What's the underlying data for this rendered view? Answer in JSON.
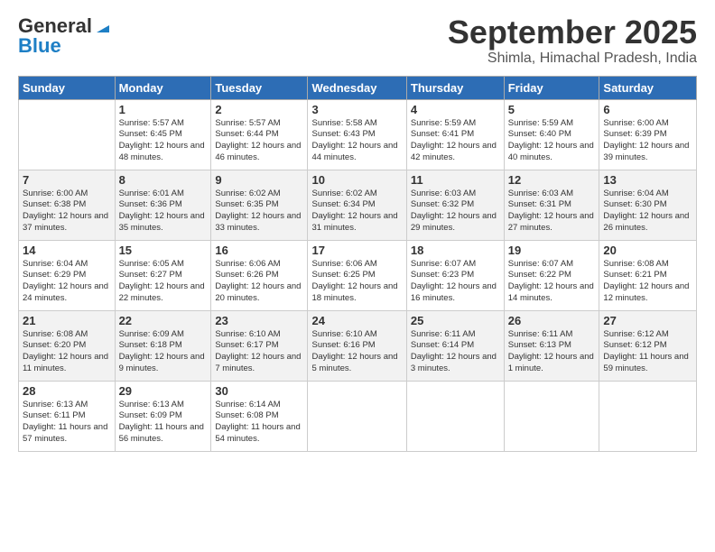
{
  "logo": {
    "general": "General",
    "blue": "Blue"
  },
  "header": {
    "month": "September 2025",
    "location": "Shimla, Himachal Pradesh, India"
  },
  "days_of_week": [
    "Sunday",
    "Monday",
    "Tuesday",
    "Wednesday",
    "Thursday",
    "Friday",
    "Saturday"
  ],
  "weeks": [
    [
      {
        "day": "",
        "info": ""
      },
      {
        "day": "1",
        "info": "Sunrise: 5:57 AM\nSunset: 6:45 PM\nDaylight: 12 hours\nand 48 minutes."
      },
      {
        "day": "2",
        "info": "Sunrise: 5:57 AM\nSunset: 6:44 PM\nDaylight: 12 hours\nand 46 minutes."
      },
      {
        "day": "3",
        "info": "Sunrise: 5:58 AM\nSunset: 6:43 PM\nDaylight: 12 hours\nand 44 minutes."
      },
      {
        "day": "4",
        "info": "Sunrise: 5:59 AM\nSunset: 6:41 PM\nDaylight: 12 hours\nand 42 minutes."
      },
      {
        "day": "5",
        "info": "Sunrise: 5:59 AM\nSunset: 6:40 PM\nDaylight: 12 hours\nand 40 minutes."
      },
      {
        "day": "6",
        "info": "Sunrise: 6:00 AM\nSunset: 6:39 PM\nDaylight: 12 hours\nand 39 minutes."
      }
    ],
    [
      {
        "day": "7",
        "info": "Sunrise: 6:00 AM\nSunset: 6:38 PM\nDaylight: 12 hours\nand 37 minutes."
      },
      {
        "day": "8",
        "info": "Sunrise: 6:01 AM\nSunset: 6:36 PM\nDaylight: 12 hours\nand 35 minutes."
      },
      {
        "day": "9",
        "info": "Sunrise: 6:02 AM\nSunset: 6:35 PM\nDaylight: 12 hours\nand 33 minutes."
      },
      {
        "day": "10",
        "info": "Sunrise: 6:02 AM\nSunset: 6:34 PM\nDaylight: 12 hours\nand 31 minutes."
      },
      {
        "day": "11",
        "info": "Sunrise: 6:03 AM\nSunset: 6:32 PM\nDaylight: 12 hours\nand 29 minutes."
      },
      {
        "day": "12",
        "info": "Sunrise: 6:03 AM\nSunset: 6:31 PM\nDaylight: 12 hours\nand 27 minutes."
      },
      {
        "day": "13",
        "info": "Sunrise: 6:04 AM\nSunset: 6:30 PM\nDaylight: 12 hours\nand 26 minutes."
      }
    ],
    [
      {
        "day": "14",
        "info": "Sunrise: 6:04 AM\nSunset: 6:29 PM\nDaylight: 12 hours\nand 24 minutes."
      },
      {
        "day": "15",
        "info": "Sunrise: 6:05 AM\nSunset: 6:27 PM\nDaylight: 12 hours\nand 22 minutes."
      },
      {
        "day": "16",
        "info": "Sunrise: 6:06 AM\nSunset: 6:26 PM\nDaylight: 12 hours\nand 20 minutes."
      },
      {
        "day": "17",
        "info": "Sunrise: 6:06 AM\nSunset: 6:25 PM\nDaylight: 12 hours\nand 18 minutes."
      },
      {
        "day": "18",
        "info": "Sunrise: 6:07 AM\nSunset: 6:23 PM\nDaylight: 12 hours\nand 16 minutes."
      },
      {
        "day": "19",
        "info": "Sunrise: 6:07 AM\nSunset: 6:22 PM\nDaylight: 12 hours\nand 14 minutes."
      },
      {
        "day": "20",
        "info": "Sunrise: 6:08 AM\nSunset: 6:21 PM\nDaylight: 12 hours\nand 12 minutes."
      }
    ],
    [
      {
        "day": "21",
        "info": "Sunrise: 6:08 AM\nSunset: 6:20 PM\nDaylight: 12 hours\nand 11 minutes."
      },
      {
        "day": "22",
        "info": "Sunrise: 6:09 AM\nSunset: 6:18 PM\nDaylight: 12 hours\nand 9 minutes."
      },
      {
        "day": "23",
        "info": "Sunrise: 6:10 AM\nSunset: 6:17 PM\nDaylight: 12 hours\nand 7 minutes."
      },
      {
        "day": "24",
        "info": "Sunrise: 6:10 AM\nSunset: 6:16 PM\nDaylight: 12 hours\nand 5 minutes."
      },
      {
        "day": "25",
        "info": "Sunrise: 6:11 AM\nSunset: 6:14 PM\nDaylight: 12 hours\nand 3 minutes."
      },
      {
        "day": "26",
        "info": "Sunrise: 6:11 AM\nSunset: 6:13 PM\nDaylight: 12 hours\nand 1 minute."
      },
      {
        "day": "27",
        "info": "Sunrise: 6:12 AM\nSunset: 6:12 PM\nDaylight: 11 hours\nand 59 minutes."
      }
    ],
    [
      {
        "day": "28",
        "info": "Sunrise: 6:13 AM\nSunset: 6:11 PM\nDaylight: 11 hours\nand 57 minutes."
      },
      {
        "day": "29",
        "info": "Sunrise: 6:13 AM\nSunset: 6:09 PM\nDaylight: 11 hours\nand 56 minutes."
      },
      {
        "day": "30",
        "info": "Sunrise: 6:14 AM\nSunset: 6:08 PM\nDaylight: 11 hours\nand 54 minutes."
      },
      {
        "day": "",
        "info": ""
      },
      {
        "day": "",
        "info": ""
      },
      {
        "day": "",
        "info": ""
      },
      {
        "day": "",
        "info": ""
      }
    ]
  ]
}
